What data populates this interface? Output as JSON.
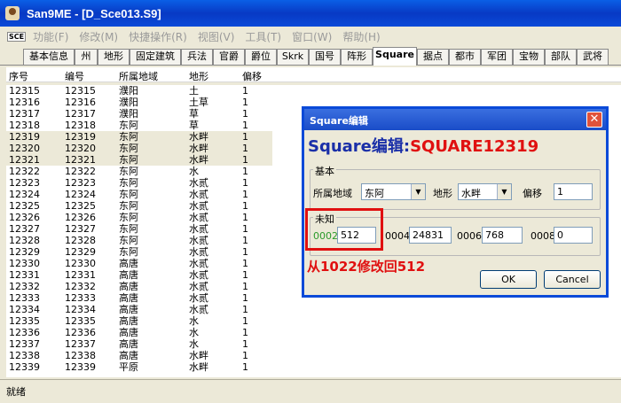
{
  "window": {
    "title": "San9ME - [D_Sce013.S9]"
  },
  "menu": {
    "logo": "SCE",
    "items": [
      "功能(F)",
      "修改(M)",
      "快捷操作(R)",
      "视图(V)",
      "工具(T)",
      "窗口(W)",
      "帮助(H)"
    ]
  },
  "tabs": [
    "基本信息",
    "州",
    "地形",
    "固定建筑",
    "兵法",
    "官爵",
    "爵位",
    "Skrk",
    "国号",
    "阵形",
    "Square",
    "据点",
    "都市",
    "军团",
    "宝物",
    "部队",
    "武将"
  ],
  "active_tab": "Square",
  "table": {
    "headers": [
      "序号",
      "编号",
      "所属地域",
      "地形",
      "偏移"
    ],
    "rows": [
      [
        "12315",
        "12315",
        "濮阳",
        "土",
        "1"
      ],
      [
        "12316",
        "12316",
        "濮阳",
        "土草",
        "1"
      ],
      [
        "12317",
        "12317",
        "濮阳",
        "草",
        "1"
      ],
      [
        "12318",
        "12318",
        "东阿",
        "草",
        "1"
      ],
      [
        "12319",
        "12319",
        "东阿",
        "水畔",
        "1"
      ],
      [
        "12320",
        "12320",
        "东阿",
        "水畔",
        "1"
      ],
      [
        "12321",
        "12321",
        "东阿",
        "水畔",
        "1"
      ],
      [
        "12322",
        "12322",
        "东阿",
        "水",
        "1"
      ],
      [
        "12323",
        "12323",
        "东阿",
        "水贰",
        "1"
      ],
      [
        "12324",
        "12324",
        "东阿",
        "水贰",
        "1"
      ],
      [
        "12325",
        "12325",
        "东阿",
        "水贰",
        "1"
      ],
      [
        "12326",
        "12326",
        "东阿",
        "水贰",
        "1"
      ],
      [
        "12327",
        "12327",
        "东阿",
        "水贰",
        "1"
      ],
      [
        "12328",
        "12328",
        "东阿",
        "水贰",
        "1"
      ],
      [
        "12329",
        "12329",
        "东阿",
        "水贰",
        "1"
      ],
      [
        "12330",
        "12330",
        "高唐",
        "水贰",
        "1"
      ],
      [
        "12331",
        "12331",
        "高唐",
        "水贰",
        "1"
      ],
      [
        "12332",
        "12332",
        "高唐",
        "水贰",
        "1"
      ],
      [
        "12333",
        "12333",
        "高唐",
        "水贰",
        "1"
      ],
      [
        "12334",
        "12334",
        "高唐",
        "水贰",
        "1"
      ],
      [
        "12335",
        "12335",
        "高唐",
        "水",
        "1"
      ],
      [
        "12336",
        "12336",
        "高唐",
        "水",
        "1"
      ],
      [
        "12337",
        "12337",
        "高唐",
        "水",
        "1"
      ],
      [
        "12338",
        "12338",
        "高唐",
        "水畔",
        "1"
      ],
      [
        "12339",
        "12339",
        "平原",
        "水畔",
        "1"
      ]
    ],
    "selected_rows": [
      4,
      5,
      6
    ]
  },
  "status": "就绪",
  "dialog": {
    "title": "Square编辑",
    "heading_prefix": "Square编辑:",
    "heading_id": "SQUARE12319",
    "basic_group": "基本",
    "region_label": "所属地域",
    "region_value": "东阿",
    "terrain_label": "地形",
    "terrain_value": "水畔",
    "offset_label": "偏移",
    "offset_value": "1",
    "unknown_group": "未知",
    "fields": [
      {
        "label": "0002",
        "value": "512"
      },
      {
        "label": "0004",
        "value": "24831"
      },
      {
        "label": "0006",
        "value": "768"
      },
      {
        "label": "0008",
        "value": "0"
      }
    ],
    "ok": "OK",
    "cancel": "Cancel",
    "close_icon": "close-icon"
  },
  "annotation": "从1022修改回512",
  "colors": {
    "label_green": "#2a9a2a",
    "annotation_red": "#e01010",
    "heading_blue": "#1a2fa8"
  }
}
